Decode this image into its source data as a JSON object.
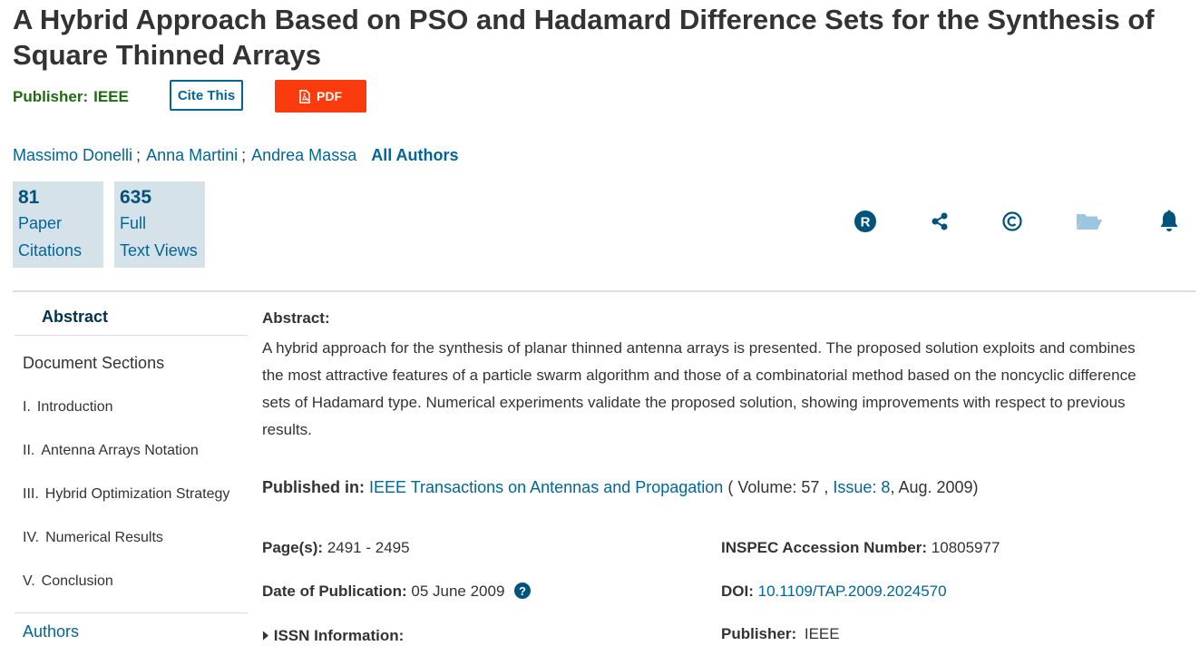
{
  "title": "A Hybrid Approach Based on PSO and Hadamard Difference Sets for the Synthesis of Square Thinned Arrays",
  "publisher_label": "Publisher:",
  "publisher_value": "IEEE",
  "cite_button": "Cite This",
  "pdf_button": "PDF",
  "authors": [
    "Massimo Donelli",
    "Anna Martini",
    "Andrea Massa"
  ],
  "author_sep": ";",
  "all_authors": "All Authors",
  "metrics": [
    {
      "value": "81",
      "line1": "Paper",
      "line2": "Citations"
    },
    {
      "value": "635",
      "line1": "Full",
      "line2": "Text Views"
    }
  ],
  "sidebar": {
    "abstract": "Abstract",
    "doc_sections": "Document Sections",
    "items": [
      {
        "num": "I.",
        "label": "Introduction"
      },
      {
        "num": "II.",
        "label": "Antenna Arrays Notation"
      },
      {
        "num": "III.",
        "label": "Hybrid Optimization Strategy"
      },
      {
        "num": "IV.",
        "label": "Numerical Results"
      },
      {
        "num": "V.",
        "label": "Conclusion"
      }
    ],
    "authors": "Authors"
  },
  "abstract": {
    "heading": "Abstract:",
    "text": "A hybrid approach for the synthesis of planar thinned antenna arrays is presented. The proposed solution exploits and combines the most attractive features of a particle swarm algorithm and those of a combinatorial method based on the noncyclic difference sets of Hadamard type. Numerical experiments validate the proposed solution, showing improvements with respect to previous results."
  },
  "published_in": {
    "label": "Published in:",
    "journal": "IEEE Transactions on Antennas and Propagation",
    "volume_prefix": "( Volume: 57 ,",
    "issue": "Issue: 8",
    "suffix": ", Aug. 2009)"
  },
  "meta": {
    "pages_label": "Page(s):",
    "pages_value": "2491 - 2495",
    "date_label": "Date of Publication:",
    "date_value": "05 June 2009",
    "issn_label": "ISSN Information:",
    "inspec_label": "INSPEC Accession Number:",
    "inspec_value": "10805977",
    "doi_label": "DOI:",
    "doi_value": "10.1109/TAP.2009.2024570",
    "publisher_label": "Publisher:",
    "publisher_value": "IEEE"
  },
  "colors": {
    "link": "#006699",
    "pdf": "#fa3b0d",
    "publisher": "#1f6b12",
    "metric_bg": "#d6e2ea"
  }
}
